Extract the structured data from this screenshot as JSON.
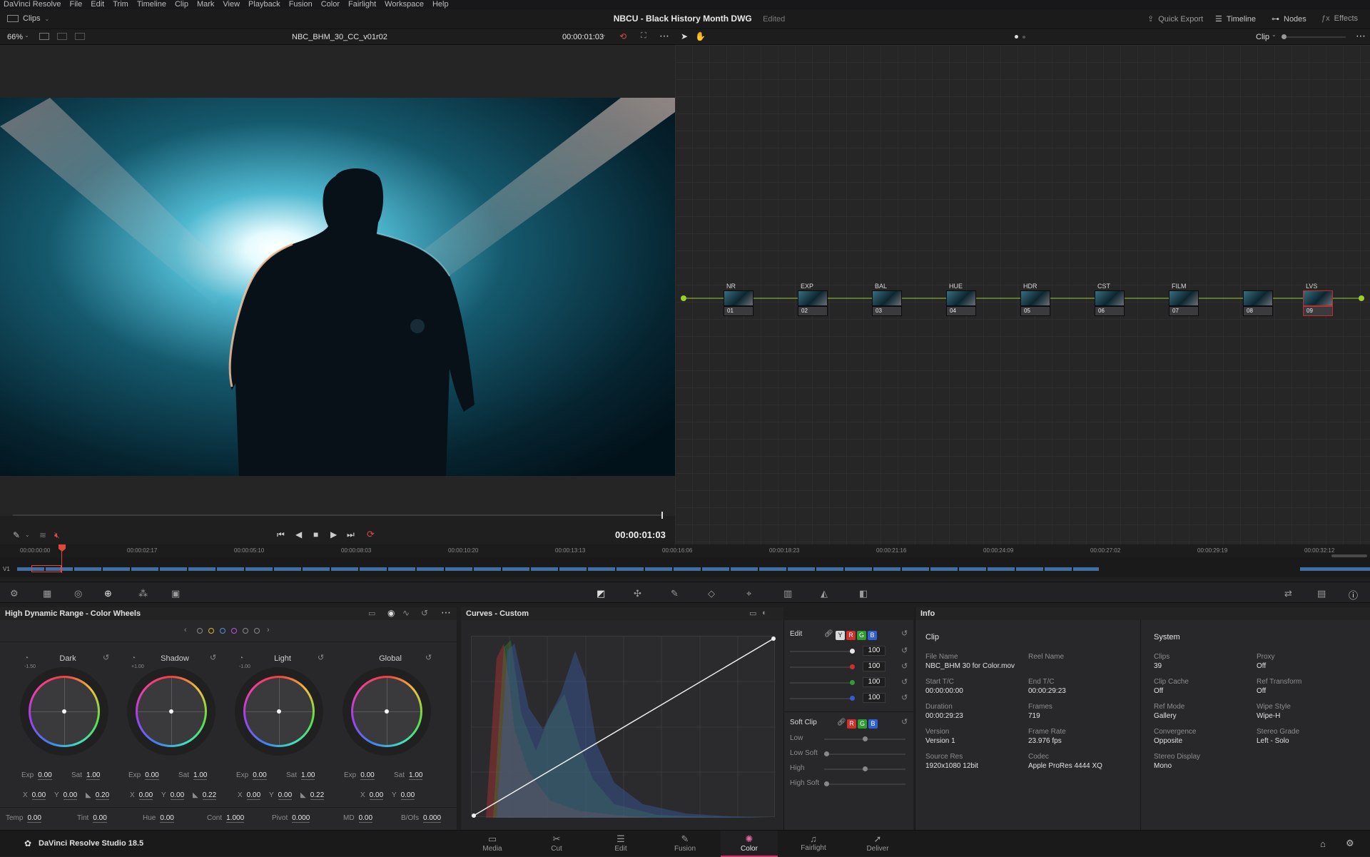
{
  "menu": [
    "DaVinci Resolve",
    "File",
    "Edit",
    "Trim",
    "Timeline",
    "Clip",
    "Mark",
    "View",
    "Playback",
    "Fusion",
    "Color",
    "Fairlight",
    "Workspace",
    "Help"
  ],
  "titlebar": {
    "clips_label": "Clips",
    "project_title": "NBCU - Black History Month DWG",
    "edited_label": "Edited",
    "quick_export": "Quick Export",
    "timeline_btn": "Timeline",
    "nodes_btn": "Nodes",
    "effects_btn": "Effects"
  },
  "viewer": {
    "zoom": "66%",
    "clip_name": "NBC_BHM_30_CC_v01r02",
    "timecode_top": "00:00:01:03",
    "timecode_bottom": "00:00:01:03"
  },
  "node_toolbar": {
    "mode": "Clip"
  },
  "nodes": [
    {
      "label": "NR",
      "num": "01"
    },
    {
      "label": "EXP",
      "num": "02"
    },
    {
      "label": "BAL",
      "num": "03"
    },
    {
      "label": "HUE",
      "num": "04"
    },
    {
      "label": "HDR",
      "num": "05"
    },
    {
      "label": "CST",
      "num": "06"
    },
    {
      "label": "FILM",
      "num": "07"
    },
    {
      "label": "",
      "num": "08"
    },
    {
      "label": "LVS",
      "num": "09"
    }
  ],
  "timeline": {
    "track": "V1",
    "ticks": [
      "00:00:00:00",
      "00:00:02:17",
      "00:00:05:10",
      "00:00:08:03",
      "00:00:10:20",
      "00:00:13:13",
      "00:00:16:06",
      "00:00:18:23",
      "00:00:21:16",
      "00:00:24:09",
      "00:00:27:02",
      "00:00:29:19",
      "00:00:32:12"
    ]
  },
  "wheels": {
    "title": "High Dynamic Range - Color Wheels",
    "wheels": [
      {
        "name": "Dark",
        "zone": "-1.50",
        "exp": "0.00",
        "sat": "1.00",
        "x": "0.00",
        "y": "0.00",
        "l": "0.20"
      },
      {
        "name": "Shadow",
        "zone": "+1.00",
        "exp": "0.00",
        "sat": "1.00",
        "x": "0.00",
        "y": "0.00",
        "l": "0.22"
      },
      {
        "name": "Light",
        "zone": "-1.00",
        "exp": "0.00",
        "sat": "1.00",
        "x": "0.00",
        "y": "0.00",
        "l": "0.22"
      },
      {
        "name": "Global",
        "zone": "",
        "exp": "0.00",
        "sat": "1.00",
        "x": "0.00",
        "y": "0.00",
        "l": ""
      }
    ],
    "labels": {
      "exp": "Exp",
      "sat": "Sat",
      "x": "X",
      "y": "Y"
    },
    "bottom": [
      {
        "k": "Temp",
        "v": "0.00"
      },
      {
        "k": "Tint",
        "v": "0.00"
      },
      {
        "k": "Hue",
        "v": "0.00"
      },
      {
        "k": "Cont",
        "v": "1.000"
      },
      {
        "k": "Pivot",
        "v": "0.000"
      },
      {
        "k": "MD",
        "v": "0.00"
      },
      {
        "k": "B/Ofs",
        "v": "0.000"
      }
    ]
  },
  "curves": {
    "title": "Curves - Custom",
    "edit_label": "Edit",
    "channels": [
      "Y",
      "R",
      "G",
      "B"
    ],
    "values": [
      "100",
      "100",
      "100",
      "100"
    ],
    "soft_clip_label": "Soft Clip",
    "soft_rows": [
      "Low",
      "Low Soft",
      "High",
      "High Soft"
    ]
  },
  "info": {
    "title": "Info",
    "clip_section": "Clip",
    "system_section": "System",
    "clip": [
      {
        "k": "File Name",
        "v": "NBC_BHM 30 for Color.mov"
      },
      {
        "k": "Reel Name",
        "v": ""
      },
      {
        "k": "Start T/C",
        "v": "00:00:00:00"
      },
      {
        "k": "End T/C",
        "v": "00:00:29:23"
      },
      {
        "k": "Duration",
        "v": "00:00:29:23"
      },
      {
        "k": "Frames",
        "v": "719"
      },
      {
        "k": "Version",
        "v": "Version 1"
      },
      {
        "k": "Frame Rate",
        "v": "23.976 fps"
      },
      {
        "k": "Source Res",
        "v": "1920x1080 12bit"
      },
      {
        "k": "Codec",
        "v": "Apple ProRes 4444 XQ"
      }
    ],
    "system": [
      {
        "k": "Clips",
        "v": "39"
      },
      {
        "k": "Proxy",
        "v": "Off"
      },
      {
        "k": "Clip Cache",
        "v": "Off"
      },
      {
        "k": "Ref Transform",
        "v": "Off"
      },
      {
        "k": "Ref Mode",
        "v": "Gallery"
      },
      {
        "k": "Wipe Style",
        "v": "Wipe-H"
      },
      {
        "k": "Convergence",
        "v": "Opposite"
      },
      {
        "k": "Stereo Grade",
        "v": "Left - Solo"
      },
      {
        "k": "Stereo Display",
        "v": "Mono"
      }
    ]
  },
  "bottombar": {
    "app_name": "DaVinci Resolve Studio 18.5",
    "pages": [
      "Media",
      "Cut",
      "Edit",
      "Fusion",
      "Color",
      "Fairlight",
      "Deliver"
    ],
    "active_page": "Color"
  },
  "colors": {
    "accent": "#e0306a",
    "playhead": "#e0483b",
    "clip_blue": "#3f6fa5",
    "node_link": "#9bcf2a",
    "node_selected": "#c12c2c"
  }
}
